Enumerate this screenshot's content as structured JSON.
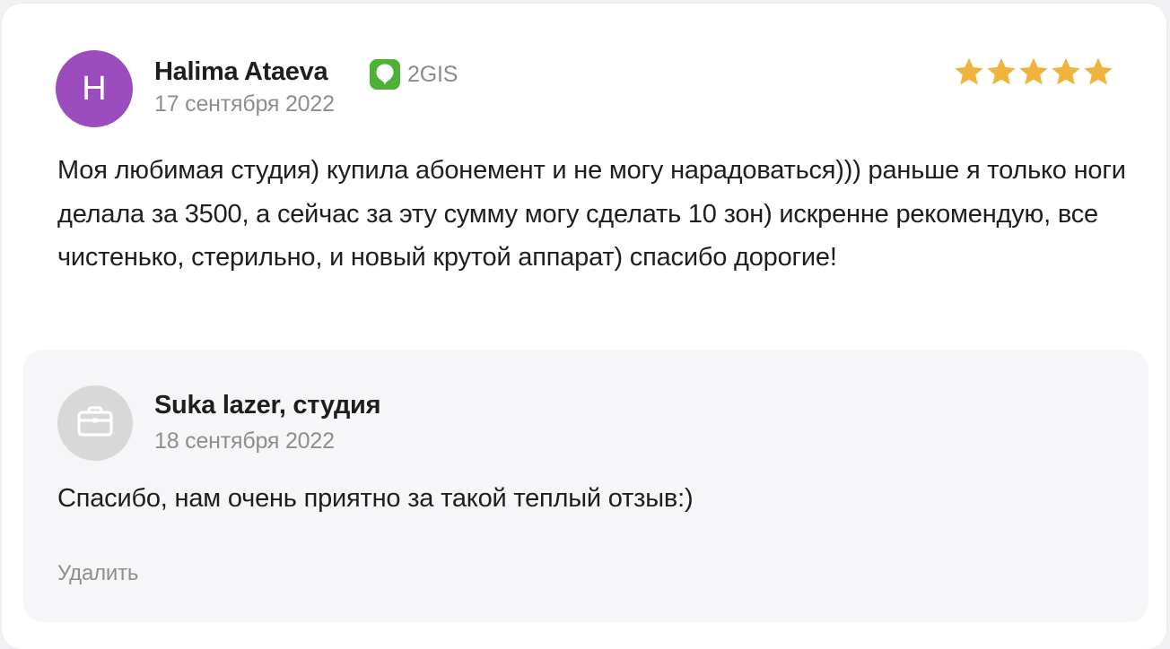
{
  "review": {
    "avatar_letter": "H",
    "avatar_color": "#9c4dbd",
    "author": "Halima Ataeva",
    "source": {
      "label": "2GIS",
      "icon": "2gis-logo-icon",
      "color": "#4cb135"
    },
    "date": "17 сентября 2022",
    "rating": 5,
    "rating_max": 5,
    "star_color": "#f0b43c",
    "text": "Моя любимая студия) купила абонемент и не могу нарадоваться))) раньше я только ноги делала за 3500, а сейчас за эту сумму могу сделать 10 зон) искренне рекомендую, все чистенько, стерильно, и новый крутой аппарат) спасибо дорогие!"
  },
  "reply": {
    "avatar_icon": "briefcase-icon",
    "avatar_color": "#d8d8d8",
    "author": "Suka lazer, студия",
    "date": "18 сентября 2022",
    "text": "Спасибо, нам очень приятно за такой теплый отзыв:)",
    "delete_label": "Удалить"
  }
}
